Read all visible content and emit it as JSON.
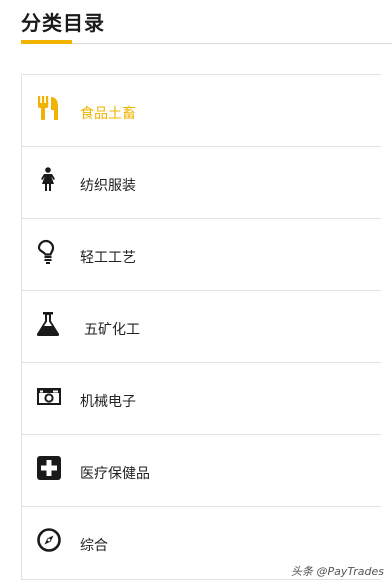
{
  "header": {
    "title": "分类目录"
  },
  "accent_color": "#f0b400",
  "categories": [
    {
      "label": "食品土畜",
      "icon": "cutlery-icon",
      "active": true
    },
    {
      "label": "纺织服装",
      "icon": "woman-figure-icon",
      "active": false
    },
    {
      "label": "轻工工艺",
      "icon": "lightbulb-icon",
      "active": false
    },
    {
      "label": "五矿化工",
      "icon": "flask-icon",
      "active": false
    },
    {
      "label": "机械电子",
      "icon": "camera-icon",
      "active": false
    },
    {
      "label": "医疗保健品",
      "icon": "medical-cross-icon",
      "active": false
    },
    {
      "label": "综合",
      "icon": "compass-icon",
      "active": false
    }
  ],
  "watermark": "头条 @PayTrades"
}
